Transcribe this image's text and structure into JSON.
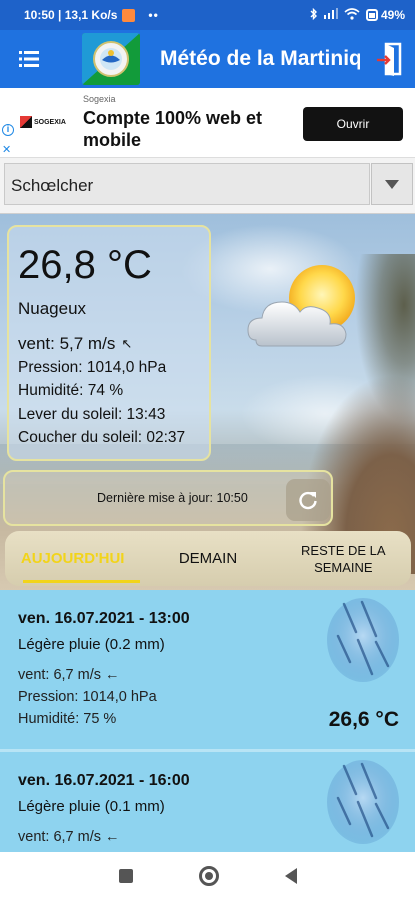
{
  "status": {
    "time_speed": "10:50 | 13,1 Ko/s",
    "dots": "••",
    "battery": "49%",
    "icons": [
      "bluetooth-icon",
      "signal-icon",
      "wifi-icon",
      "battery-icon"
    ]
  },
  "app_bar": {
    "title": "Météo de la Martinique",
    "icons": [
      "menu-icon",
      "app-logo",
      "exit-icon"
    ]
  },
  "ad": {
    "brand": "Sogexia",
    "headline": "Compte 100% web et mobile",
    "cta": "Ouvrir",
    "logo_text": "SOGEXIA"
  },
  "city": {
    "selected": "Schœlcher"
  },
  "current": {
    "temperature": "26,8 °C",
    "condition": "Nuageux",
    "wind": "vent: 5,7 m/s",
    "pressure": "Pression: 1014,0 hPa",
    "humidity": "Humidité: 74 %",
    "sunrise": "Lever du soleil: 13:43",
    "sunset": "Coucher du soleil: 02:37"
  },
  "update": {
    "text": "Dernière mise à jour: 10:50"
  },
  "tabs": [
    {
      "label": "AUJOURD'HUI",
      "active": true
    },
    {
      "label": "DEMAIN",
      "active": false
    },
    {
      "label": "RESTE DE LA SEMAINE",
      "active": false
    }
  ],
  "forecast": [
    {
      "datetime": "ven. 16.07.2021 - 13:00",
      "description": "Légère pluie (0.2 mm)",
      "wind": "vent: 6,7 m/s",
      "pressure": "Pression: 1014,0 hPa",
      "humidity": "Humidité: 75 %",
      "temperature": "26,6 °C"
    },
    {
      "datetime": "ven. 16.07.2021 - 16:00",
      "description": "Légère pluie (0.1 mm)",
      "wind": "vent: 6,7 m/s"
    }
  ],
  "colors": {
    "status_bar": "#1e62c9",
    "app_bar": "#1f72e0",
    "active_tab": "#f2d41a",
    "forecast_bg": "#8fd4ef"
  }
}
